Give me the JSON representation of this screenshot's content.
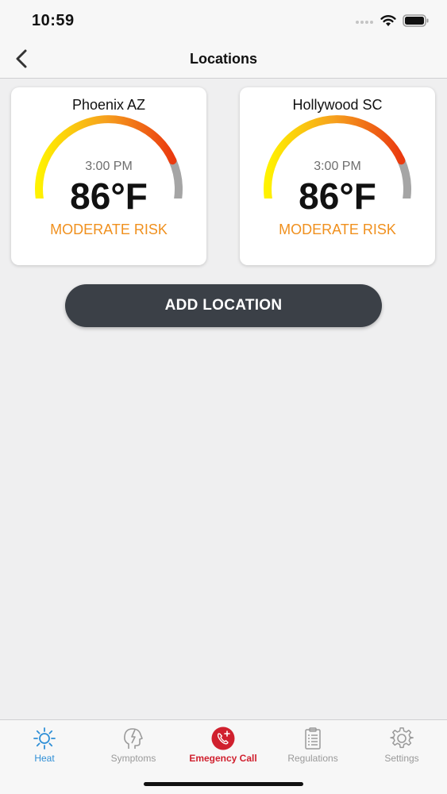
{
  "status_bar": {
    "time": "10:59",
    "icons": [
      "signal-icon",
      "wifi-icon",
      "battery-icon"
    ]
  },
  "nav": {
    "title": "Locations",
    "back_icon": "chevron-left-icon"
  },
  "locations": [
    {
      "name": "Phoenix AZ",
      "time": "3:00 PM",
      "temperature": "86°F",
      "risk": "MODERATE RISK",
      "gauge_level": 0.8
    },
    {
      "name": "Hollywood SC",
      "time": "3:00 PM",
      "temperature": "86°F",
      "risk": "MODERATE RISK",
      "gauge_level": 0.8
    }
  ],
  "add_button": {
    "label": "ADD LOCATION"
  },
  "tabs": [
    {
      "label": "Heat",
      "icon": "sun-icon",
      "active": true
    },
    {
      "label": "Symptoms",
      "icon": "head-lightning-icon",
      "active": false
    },
    {
      "label": "Emegency Call",
      "icon": "phone-plus-icon",
      "active": false
    },
    {
      "label": "Regulations",
      "icon": "clipboard-icon",
      "active": false
    },
    {
      "label": "Settings",
      "icon": "gear-icon",
      "active": false
    }
  ],
  "colors": {
    "risk_text": "#f0901e",
    "gauge_start": "#fff200",
    "gauge_mid": "#f6a01e",
    "gauge_end": "#ea3a0f",
    "gauge_track": "#a5a5a5",
    "active_tab": "#2f8fd6",
    "emergency": "#d0202e",
    "button_bg": "#3b4047"
  }
}
